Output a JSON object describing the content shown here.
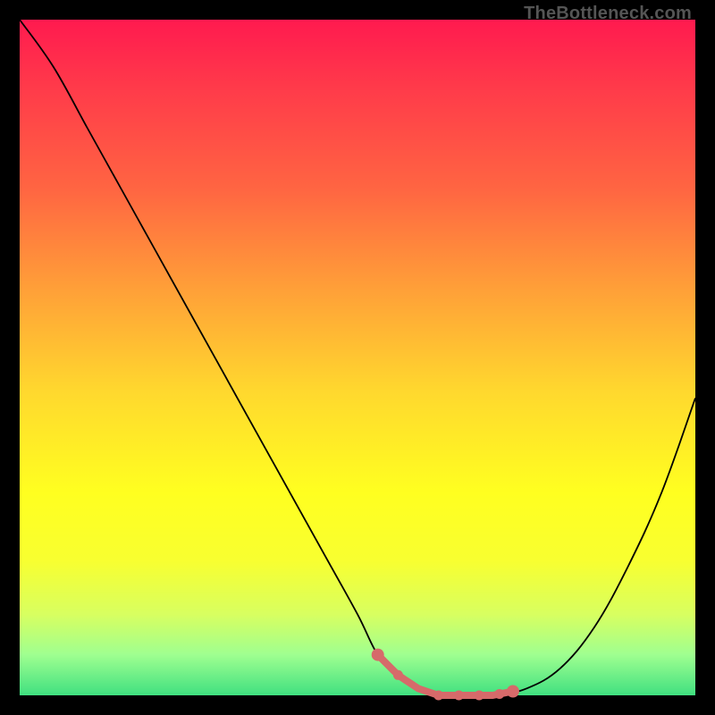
{
  "watermark": "TheBottleneck.com",
  "chart_data": {
    "type": "line",
    "title": "",
    "xlabel": "",
    "ylabel": "",
    "ylim": [
      0,
      100
    ],
    "x": [
      0,
      5,
      10,
      15,
      20,
      25,
      30,
      35,
      40,
      45,
      50,
      53,
      56,
      59,
      62,
      65,
      70,
      75,
      80,
      85,
      90,
      95,
      100
    ],
    "values": [
      100,
      93,
      84,
      75,
      66,
      57,
      48,
      39,
      30,
      21,
      12,
      6,
      3,
      1,
      0,
      0,
      0,
      1,
      4,
      10,
      19,
      30,
      44
    ],
    "highlight_range": {
      "x_start": 53,
      "x_end": 73
    },
    "markers_x": [
      53,
      56,
      62,
      65,
      68,
      71,
      73
    ],
    "gradient_stops": [
      {
        "pos": 0,
        "color": "#ff1a4f"
      },
      {
        "pos": 70,
        "color": "#ffff20"
      },
      {
        "pos": 100,
        "color": "#40e080"
      }
    ]
  }
}
